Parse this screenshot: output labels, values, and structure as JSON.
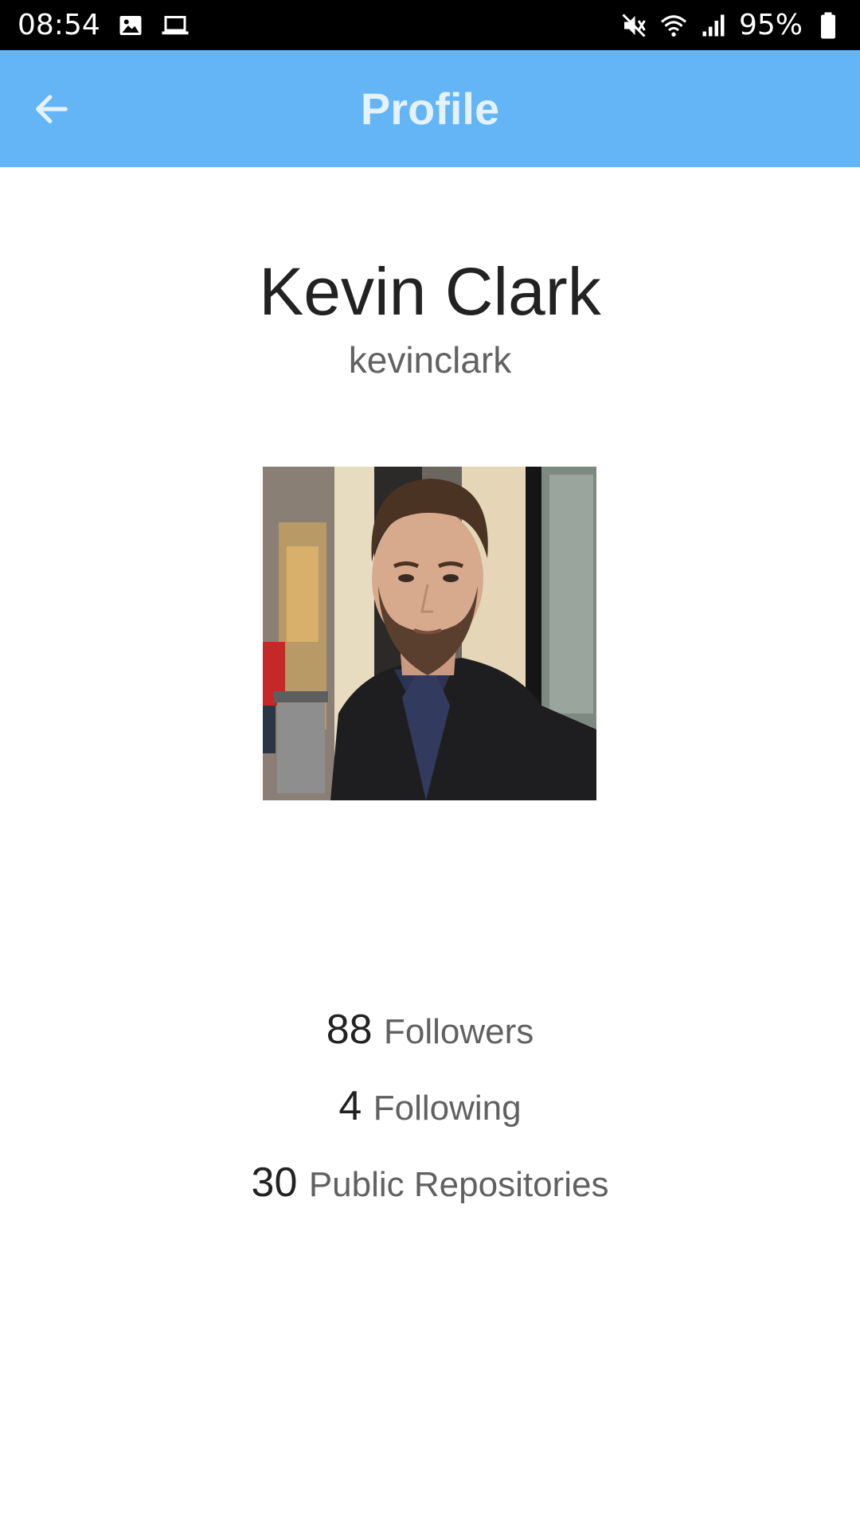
{
  "status_bar": {
    "time": "08:54",
    "battery": "95%",
    "icons_left": [
      "image-icon",
      "laptop-icon"
    ],
    "icons_right": [
      "mute-icon",
      "wifi-icon",
      "signal-icon",
      "battery-icon"
    ]
  },
  "app_bar": {
    "title": "Profile",
    "background_color": "#64b5f6",
    "back_icon": "arrow-back-icon"
  },
  "profile": {
    "name": "Kevin Clark",
    "username": "kevinclark",
    "avatar_description_icon": "avatar-photo"
  },
  "stats": [
    {
      "value": "88",
      "label": "Followers"
    },
    {
      "value": "4",
      "label": "Following"
    },
    {
      "value": "30",
      "label": "Public Repositories"
    }
  ]
}
